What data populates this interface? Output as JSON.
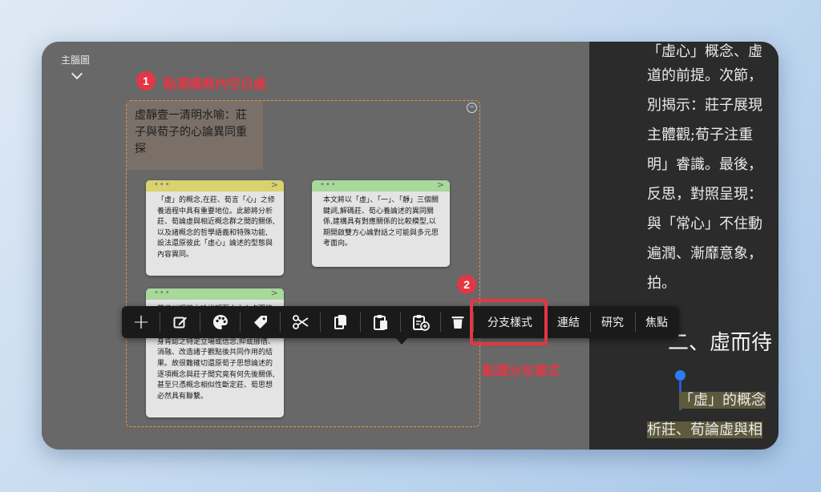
{
  "canvas": {
    "mindmap_label": "主腦圖",
    "frame_title": "虛靜壹一清明水喻：莊子與荀子的心論異同重探",
    "frame_collapse": "−"
  },
  "annotations": {
    "step1_number": "1",
    "step1_text": "點選橘框內空白處",
    "step2_number": "2",
    "step2_text": "點選分支樣式"
  },
  "notes": [
    {
      "text": "「虛」的概念,在莊、荀言「心」之修養過程中具有重要地位。此節將分析莊、荀論虛與相近概念群之間的關係,以及諸概念的哲學語義和特殊功能, 設法還原彼此「虛心」論述的型態與內容異同。"
    },
    {
      "text": "本文將以「虛」、「一」、「靜」三個關鍵詞,解碼莊、荀心養論述的異同關係,建構具有對應關係的比較模型,以期開啟雙方心論對話之可能與多元思考面向。"
    },
    {
      "text": "莊子以明鏡之喻說明至人之心虛而能照,荀子則以盤水之喻強調心虛壹而靜方能知道,本節將比較二者在工夫論上身肯認之特定立場或信念,抑或挪借、消融、改造諸子觀點後共同作用的結果。故很難確切還原荀子思想論述的逐項概念與莊子間究竟有何先後關係,甚至只憑概念相似性斷定莊、荀思想必然具有聯繫。"
    }
  ],
  "toolbar": {
    "add": "+",
    "branch_style": "分支樣式",
    "link": "連結",
    "research": "研究",
    "focus": "焦點"
  },
  "reader": {
    "lines": [
      "「虛心」概念、虛",
      "道的前提。次節，",
      "別揭示：莊子展現",
      "主體觀;荀子注重",
      "明」睿識。最後，",
      "反思，對照呈現：",
      "與「常心」不住動",
      "遍潤、漸靡意象，",
      "拍。"
    ],
    "heading": "二、虛而待",
    "highlight_lines": [
      "「虛」的概念",
      "析莊、荀論虛與相"
    ]
  },
  "colors": {
    "accent_red": "#e23744",
    "frame_orange": "#e8954a",
    "note_yellow": "#d9d26e",
    "note_green": "#a6d99a"
  }
}
